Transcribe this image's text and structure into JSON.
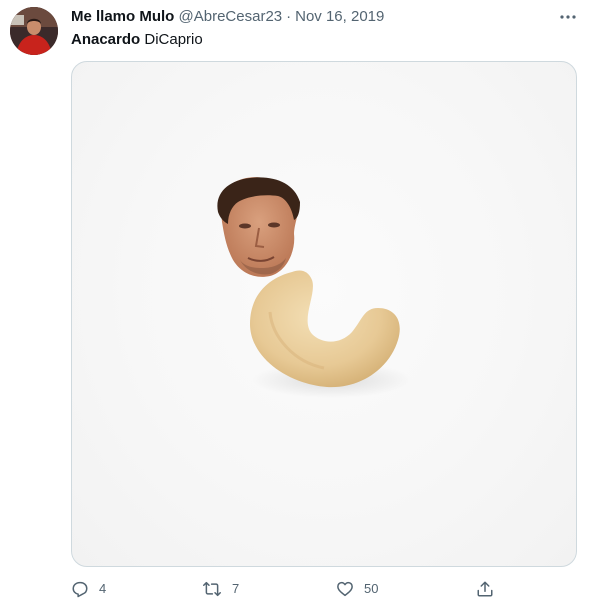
{
  "author": {
    "display_name": "Me llamo Mulo",
    "handle": "@AbreCesar23",
    "separator": "·",
    "date": "Nov 16, 2019"
  },
  "tweet": {
    "text_bold": "Anacardo",
    "text_rest": " DiCaprio"
  },
  "media": {
    "description_icon": "photo-icon",
    "background_color": "#f6f6f6",
    "nut_color": "#e9cf9c"
  },
  "actions": {
    "reply_count": "4",
    "retweet_count": "7",
    "like_count": "50"
  },
  "colors": {
    "text_primary": "#0f1419",
    "text_secondary": "#536471",
    "border": "#cfd9de"
  }
}
